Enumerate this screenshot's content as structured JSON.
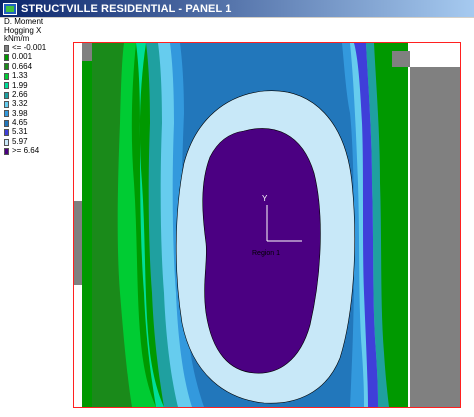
{
  "window": {
    "title": "STRUCTVILLE RESIDENTIAL - PANEL 1"
  },
  "legend": {
    "title_lines": [
      "D. Moment",
      "Hogging X",
      "kNm/m"
    ],
    "items": [
      {
        "label": "<= -0.001",
        "color": "#808080"
      },
      {
        "label": "0.001",
        "color": "#009900"
      },
      {
        "label": "0.664",
        "color": "#1a8a1a"
      },
      {
        "label": "1.33",
        "color": "#00cc33"
      },
      {
        "label": "1.99",
        "color": "#00dd99"
      },
      {
        "label": "2.66",
        "color": "#1fa0a0"
      },
      {
        "label": "3.32",
        "color": "#66ccee"
      },
      {
        "label": "3.98",
        "color": "#3399dd"
      },
      {
        "label": "4.65",
        "color": "#2277bb"
      },
      {
        "label": "5.31",
        "color": "#3f3fd9"
      },
      {
        "label": "5.97",
        "color": "#c8e8f8"
      },
      {
        "label": ">= 6.64",
        "color": "#4b0082"
      }
    ]
  },
  "plot": {
    "axis_label": "Y",
    "region_label": "Region 1"
  },
  "colors": {
    "title_bar_start": "#0a246a",
    "title_bar_end": "#a6caf0",
    "plot_border": "#ff2020"
  }
}
